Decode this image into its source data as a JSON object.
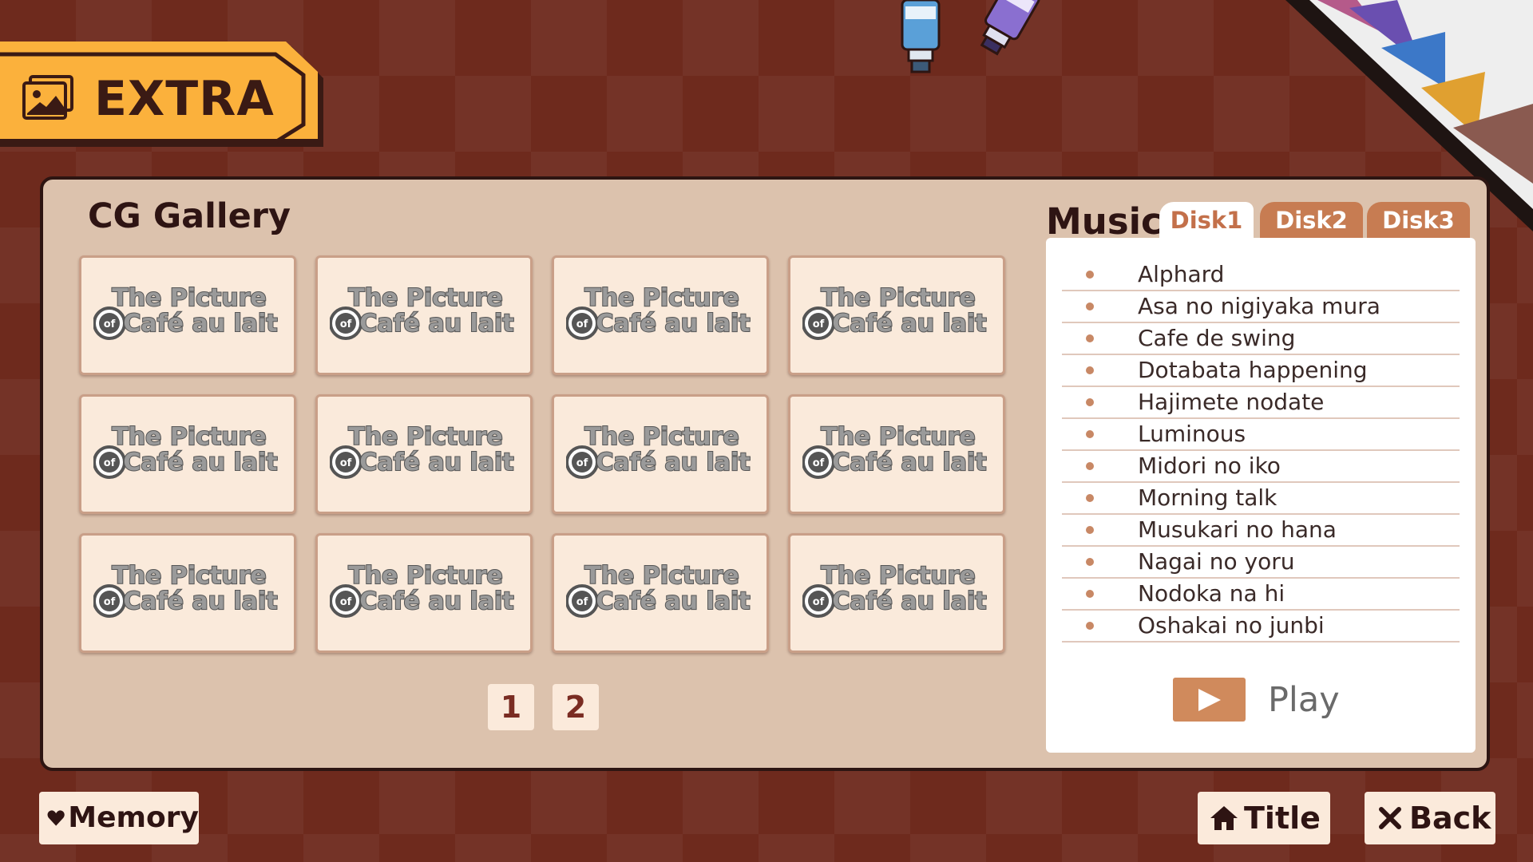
{
  "header": {
    "title": "EXTRA",
    "icon": "image-icon"
  },
  "gallery": {
    "title": "CG Gallery",
    "thumbnails": [
      {
        "line1": "The Picture",
        "of": "of",
        "line2": "Café au lait"
      },
      {
        "line1": "The Picture",
        "of": "of",
        "line2": "Café au lait"
      },
      {
        "line1": "The Picture",
        "of": "of",
        "line2": "Café au lait"
      },
      {
        "line1": "The Picture",
        "of": "of",
        "line2": "Café au lait"
      },
      {
        "line1": "The Picture",
        "of": "of",
        "line2": "Café au lait"
      },
      {
        "line1": "The Picture",
        "of": "of",
        "line2": "Café au lait"
      },
      {
        "line1": "The Picture",
        "of": "of",
        "line2": "Café au lait"
      },
      {
        "line1": "The Picture",
        "of": "of",
        "line2": "Café au lait"
      },
      {
        "line1": "The Picture",
        "of": "of",
        "line2": "Café au lait"
      },
      {
        "line1": "The Picture",
        "of": "of",
        "line2": "Café au lait"
      },
      {
        "line1": "The Picture",
        "of": "of",
        "line2": "Café au lait"
      },
      {
        "line1": "The Picture",
        "of": "of",
        "line2": "Café au lait"
      }
    ],
    "pages": [
      "1",
      "2"
    ]
  },
  "music": {
    "title": "Music",
    "tabs": [
      {
        "label": "Disk1",
        "active": true
      },
      {
        "label": "Disk2",
        "active": false
      },
      {
        "label": "Disk3",
        "active": false
      }
    ],
    "tracks": [
      "Alphard",
      "Asa no nigiyaka mura",
      "Cafe de swing",
      "Dotabata happening",
      "Hajimete nodate",
      "Luminous",
      "Midori no iko",
      "Morning talk",
      "Musukari no hana",
      "Nagai no yoru",
      "Nodoka na hi",
      "Oshakai no junbi"
    ],
    "play_label": "Play"
  },
  "footer": {
    "memory_label": "Memory",
    "title_label": "Title",
    "back_label": "Back"
  },
  "colors": {
    "background": "#6e2a1d",
    "panel": "#dcc2ad",
    "tag": "#fbb13c",
    "accent": "#c77c52"
  }
}
